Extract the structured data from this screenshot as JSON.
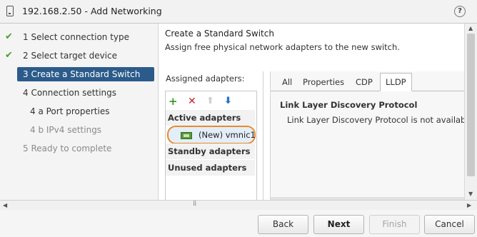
{
  "window": {
    "title": "192.168.2.50 - Add Networking",
    "help_symbol": "?"
  },
  "steps": [
    {
      "label": "1  Select connection type",
      "state": "done"
    },
    {
      "label": "2  Select target device",
      "state": "done"
    },
    {
      "label": "3  Create a Standard Switch",
      "state": "active"
    },
    {
      "label": "4  Connection settings",
      "state": "pending"
    },
    {
      "label": "4 a  Port properties",
      "state": "pending"
    },
    {
      "label": "4 b  IPv4 settings",
      "state": "disabled"
    },
    {
      "label": "5  Ready to complete",
      "state": "disabled"
    }
  ],
  "page": {
    "heading": "Create a Standard Switch",
    "subheading": "Assign free physical network adapters to the new switch."
  },
  "adapters": {
    "label": "Assigned adapters:",
    "toolbar": {
      "add": "+",
      "remove": "✕",
      "move_up": "⬆",
      "move_down": "⬇"
    },
    "groups": {
      "active": "Active adapters",
      "standby": "Standby adapters",
      "unused": "Unused adapters"
    },
    "active_items": [
      "(New) vmnic1"
    ]
  },
  "details": {
    "tabs": [
      "All",
      "Properties",
      "CDP",
      "LLDP"
    ],
    "selected_tab": "LLDP",
    "section_title": "Link Layer Discovery Protocol",
    "message": "Link Layer Discovery Protocol is not available"
  },
  "buttons": {
    "back": "Back",
    "next": "Next",
    "finish": "Finish",
    "cancel": "Cancel"
  },
  "colors": {
    "active_step_bg": "#2b5b8a",
    "check_green": "#4a9e2f",
    "highlight_ring": "#e88b2d",
    "add_icon": "#3a9a2a",
    "remove_icon": "#cc2222",
    "move_down_icon": "#2a6fc9"
  }
}
